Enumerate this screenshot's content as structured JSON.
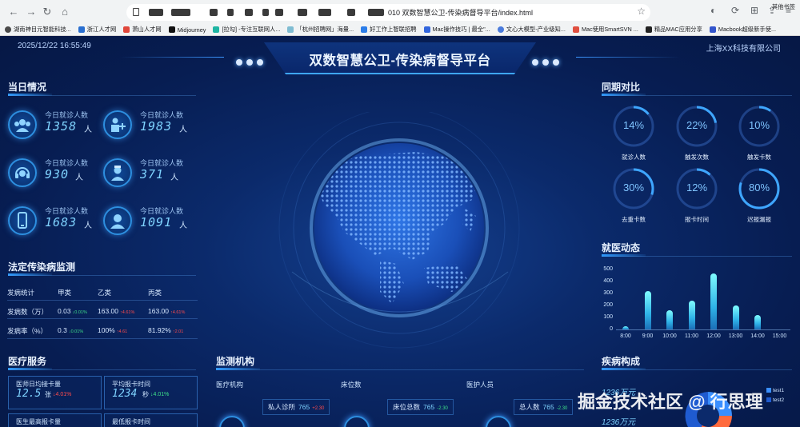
{
  "browser": {
    "url": "010 双数智慧公卫-传染病督导平台/index.html",
    "bookmarks": [
      "湖南神目元智能科技...",
      "浙江人才网",
      "萧山人才网",
      "Midjourney",
      "[拉勾] -专注互联网人...",
      "「杭州招聘网」海量...",
      "好工作上智联招聘",
      "Mac操作技巧 | 最全\"...",
      "文心大模型-产业级知...",
      "Mac使用SmartSVN ...",
      "精品MAC应用分享",
      "Macbook超级新手使..."
    ],
    "other_bookmarks": "其他书签"
  },
  "header": {
    "datetime": "2025/12/22 16:55:49",
    "title": "双数智慧公卫-传染病督导平台",
    "company": "上海XX科技有限公司"
  },
  "today": {
    "title": "当日情况",
    "stats": [
      {
        "label": "今日就诊人数",
        "value": "1358",
        "unit": "人",
        "icon": "group-icon"
      },
      {
        "label": "今日就诊人数",
        "value": "1983",
        "unit": "人",
        "icon": "doctor-patient-icon"
      },
      {
        "label": "今日就诊人数",
        "value": "930",
        "unit": "人",
        "icon": "headset-icon"
      },
      {
        "label": "今日就诊人数",
        "value": "371",
        "unit": "人",
        "icon": "nurse-icon"
      },
      {
        "label": "今日就诊人数",
        "value": "1683",
        "unit": "人",
        "icon": "phone-icon"
      },
      {
        "label": "今日就诊人数",
        "value": "1091",
        "unit": "人",
        "icon": "person-icon"
      }
    ]
  },
  "disease": {
    "title": "法定传染病监测",
    "headers": [
      "发病统计",
      "甲类",
      "乙类",
      "丙类"
    ],
    "rows": [
      {
        "label": "发病数（万）",
        "a": "0.03",
        "a_chg": "↓0.01%",
        "b": "163.00",
        "b_chg": "↑4.61%",
        "c": "163.00",
        "c_chg": "↑4.61%"
      },
      {
        "label": "发病率（%）",
        "a": "0.3",
        "a_chg": "↓0.01%",
        "b": "100%",
        "b_chg": "↑4.61",
        "c": "81.92%",
        "c_chg": "↑2.01"
      }
    ]
  },
  "medical": {
    "title": "医疗服务",
    "cards": [
      {
        "label": "医师日均接卡量",
        "value": "12.5",
        "unit": "张",
        "chg": "↓4.01%"
      },
      {
        "label": "平均报卡时间",
        "value": "1234",
        "unit": "秒",
        "chg": "↓4.01%"
      },
      {
        "label": "医生最高报卡量",
        "value": "",
        "unit": "",
        "chg": ""
      },
      {
        "label": "最低报卡时间",
        "value": "",
        "unit": "",
        "chg": ""
      }
    ]
  },
  "monitor": {
    "title": "监测机构",
    "headers": [
      "医疗机构",
      "床位数",
      "医护人员"
    ],
    "rows": [
      {
        "label": "私人诊所",
        "value": "765",
        "chg": "+2.30"
      },
      {
        "label": "床位总数",
        "value": "765",
        "chg": "-2.30"
      },
      {
        "label": "总人数",
        "value": "765",
        "chg": "-2.30"
      }
    ]
  },
  "compare": {
    "title": "同期对比",
    "rings": [
      {
        "pct": "14%",
        "value": 14,
        "label": "就诊人数"
      },
      {
        "pct": "22%",
        "value": 22,
        "label": "触发次数"
      },
      {
        "pct": "10%",
        "value": 10,
        "label": "触发卡数"
      },
      {
        "pct": "30%",
        "value": 30,
        "label": "去重卡数"
      },
      {
        "pct": "12%",
        "value": 12,
        "label": "报卡时间"
      },
      {
        "pct": "80%",
        "value": 80,
        "label": "迟报漏报"
      }
    ]
  },
  "visits": {
    "title": "就医动态",
    "chart_data": {
      "type": "bar",
      "categories": [
        "8:00",
        "9:00",
        "10:00",
        "11:00",
        "12:00",
        "13:00",
        "14:00",
        "15:00"
      ],
      "values": [
        30,
        320,
        160,
        240,
        470,
        200,
        120,
        0
      ],
      "yticks": [
        "500",
        "400",
        "300",
        "200",
        "100",
        "0"
      ],
      "ylim": [
        0,
        500
      ]
    }
  },
  "illness": {
    "title": "疾病构成",
    "values": [
      "1236万元",
      "1236万元"
    ],
    "legend": [
      "test1",
      "test2"
    ]
  },
  "watermark": "掘金技术社区 @ 行思理"
}
